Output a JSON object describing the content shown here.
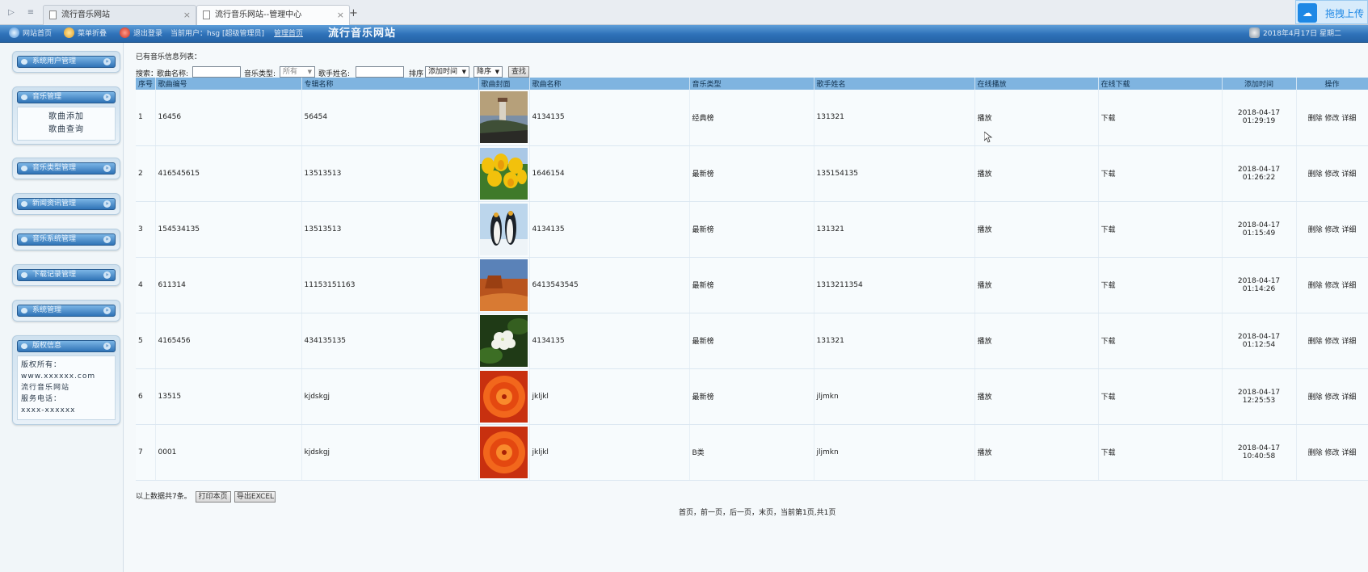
{
  "browser": {
    "tabs": [
      {
        "title": "流行音乐网站",
        "active": false
      },
      {
        "title": "流行音乐网站--管理中心",
        "active": true
      }
    ],
    "upload_widget_label": "拖拽上传"
  },
  "topbar": {
    "home_label": "网站首页",
    "favorites_label": "菜单折叠",
    "logout_label": "退出登录",
    "current_user_label": "当前用户：",
    "current_user": "hsg",
    "role": "[超级管理员]",
    "admin_home_label": "管理首页",
    "site_title": "流行音乐网站",
    "date": "2018年4月17日 星期二"
  },
  "sidebar": {
    "menus": [
      {
        "label": "系统用户管理",
        "items": []
      },
      {
        "label": "音乐管理",
        "items": [
          "歌曲添加",
          "歌曲查询"
        ]
      },
      {
        "label": "音乐类型管理",
        "items": []
      },
      {
        "label": "新闻资讯管理",
        "items": []
      },
      {
        "label": "音乐系统管理",
        "items": []
      },
      {
        "label": "下载记录管理",
        "items": []
      },
      {
        "label": "系统管理",
        "items": []
      }
    ],
    "copyright": {
      "label": "版权信息",
      "lines": [
        "版权所有：",
        "www.xxxxxx.com",
        "流行音乐网站",
        "服务电话：",
        "xxxx-xxxxxx"
      ]
    }
  },
  "main": {
    "caption": "已有音乐信息列表：",
    "search": {
      "prefix": "搜索：",
      "song_name_label": "歌曲名称:",
      "song_name_value": "",
      "type_label": "音乐类型:",
      "type_value": "所有",
      "singer_label": "歌手姓名:",
      "singer_value": "",
      "sort_label": "排序",
      "sort_field": "添加时间",
      "sort_order": "降序",
      "query_button": "查找"
    },
    "columns": [
      "序号",
      "歌曲编号",
      "专辑名称",
      "歌曲封面",
      "歌曲名称",
      "音乐类型",
      "歌手姓名",
      "在线播放",
      "在线下载",
      "添加时间",
      "操作"
    ],
    "rows": [
      {
        "index": "1",
        "song_no": "16456",
        "album": "56454",
        "cover": "lighthouse",
        "name": "4134135",
        "type": "经典榜",
        "singer": "131321",
        "play": "播放",
        "download": "下载",
        "date": "2018-04-17",
        "time": "01:29:19"
      },
      {
        "index": "2",
        "song_no": "416545615",
        "album": "13513513",
        "cover": "tulips",
        "name": "1646154",
        "type": "最新榜",
        "singer": "135154135",
        "play": "播放",
        "download": "下载",
        "date": "2018-04-17",
        "time": "01:26:22"
      },
      {
        "index": "3",
        "song_no": "154534135",
        "album": "13513513",
        "cover": "penguins",
        "name": "4134135",
        "type": "最新榜",
        "singer": "131321",
        "play": "播放",
        "download": "下载",
        "date": "2018-04-17",
        "time": "01:15:49"
      },
      {
        "index": "4",
        "song_no": "611314",
        "album": "11153151163",
        "cover": "desert",
        "name": "6413543545",
        "type": "最新榜",
        "singer": "1313211354",
        "play": "播放",
        "download": "下载",
        "date": "2018-04-17",
        "time": "01:14:26"
      },
      {
        "index": "5",
        "song_no": "4165456",
        "album": "434135135",
        "cover": "hydrangea",
        "name": "4134135",
        "type": "最新榜",
        "singer": "131321",
        "play": "播放",
        "download": "下载",
        "date": "2018-04-17",
        "time": "01:12:54"
      },
      {
        "index": "6",
        "song_no": "13515",
        "album": "kjdskgj",
        "cover": "chrysanthemum",
        "name": "jkljkl",
        "type": "最新榜",
        "singer": "jljmkn",
        "play": "播放",
        "download": "下载",
        "date": "2018-04-17",
        "time": "12:25:53"
      },
      {
        "index": "7",
        "song_no": "0001",
        "album": "kjdskgj",
        "cover": "chrysanthemum",
        "name": "jkljkl",
        "type": "B类",
        "singer": "jljmkn",
        "play": "播放",
        "download": "下载",
        "date": "2018-04-17",
        "time": "10:40:58"
      }
    ],
    "actions": [
      "删除",
      "修改",
      "详细"
    ],
    "total_text": "以上数据共7条。",
    "print_button": "打印本页",
    "export_button": "导出EXCEL",
    "pager_text": "首页，前一页，后一页，末页，当前第1页,共1页"
  }
}
